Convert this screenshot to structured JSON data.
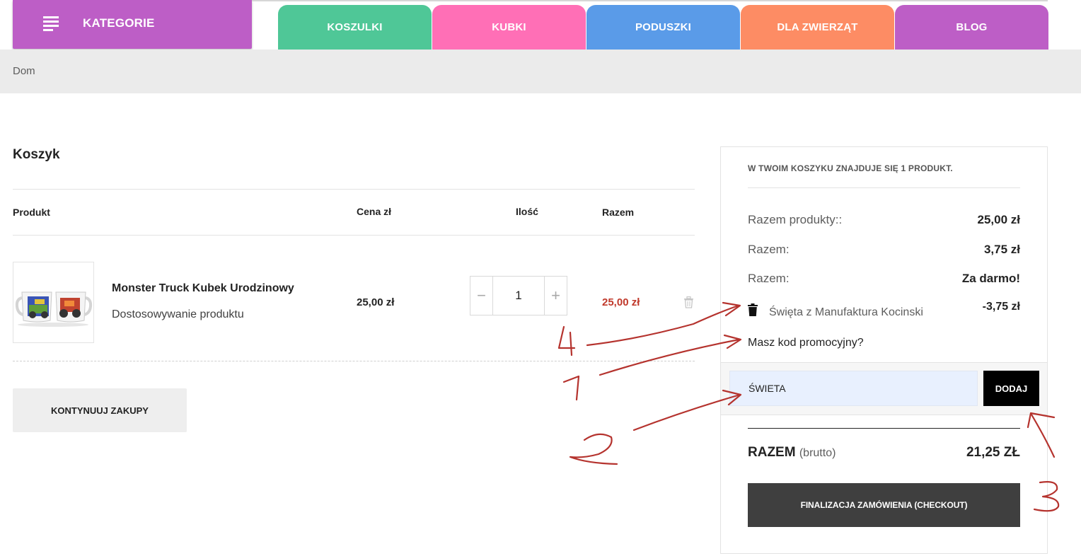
{
  "header": {
    "categories_label": "KATEGORIE",
    "tabs": [
      {
        "label": "KOSZULKI",
        "color": "#4fc797"
      },
      {
        "label": "KUBKI",
        "color": "#ff6fb6"
      },
      {
        "label": "PODUSZKI",
        "color": "#5a9be8"
      },
      {
        "label": "DLA ZWIERZĄT",
        "color": "#fd8c64"
      },
      {
        "label": "BLOG",
        "color": "#bd5ec6"
      }
    ]
  },
  "breadcrumb": {
    "home": "Dom"
  },
  "cart": {
    "title": "Koszyk",
    "columns": {
      "product": "Produkt",
      "price": "Cena zł",
      "qty": "Ilość",
      "total": "Razem"
    },
    "items": [
      {
        "name": "Monster Truck Kubek Urodzinowy",
        "customization": "Dostosowywanie produktu",
        "price": "25,00 zł",
        "quantity": "1",
        "total": "25,00 zł",
        "qty_minus": "−",
        "qty_plus": "+"
      }
    ],
    "continue_label": "KONTYNUUJ ZAKUPY"
  },
  "summary": {
    "count_text": "W TWOIM KOSZYKU ZNAJDUJE SIĘ 1 PRODUKT.",
    "rows": [
      {
        "label": "Razem produkty::",
        "value": "25,00 zł"
      },
      {
        "label": "Razem:",
        "value": "3,75 zł"
      },
      {
        "label": "Razem:",
        "value": "Za darmo!"
      }
    ],
    "voucher": {
      "name": "Święta z Manufaktura Kocinski",
      "value": "-3,75 zł"
    },
    "promo_question": "Masz kod promocyjny?",
    "promo_input_value": "ŚWIETA",
    "promo_button": "DODAJ",
    "total_label": "RAZEM",
    "total_suffix": "(brutto)",
    "total_value": "21,25 ZŁ",
    "checkout_label": "FINALIZACJA ZAMÓWIENIA (CHECKOUT)"
  },
  "annotations": {
    "color": "#b5332e",
    "numbers": [
      "4",
      "1",
      "2",
      "3"
    ]
  }
}
